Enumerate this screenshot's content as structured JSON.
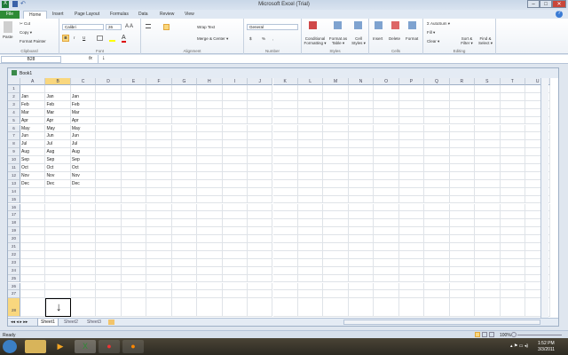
{
  "window": {
    "title": "Microsoft Excel (Trial)",
    "minimize": "–",
    "maximize": "□",
    "close": "✕"
  },
  "tabs": [
    "File",
    "Home",
    "Insert",
    "Page Layout",
    "Formulas",
    "Data",
    "Review",
    "View"
  ],
  "ribbon": {
    "clipboard": {
      "paste": "Paste",
      "cut": "Cut",
      "copy": "Copy ▾",
      "format_painter": "Format Painter",
      "label": "Clipboard"
    },
    "font": {
      "name": "Calibri",
      "size": "26",
      "bold": "B",
      "italic": "I",
      "underline": "U",
      "label": "Font"
    },
    "alignment": {
      "wrap": "Wrap Text",
      "merge": "Merge & Center ▾",
      "label": "Alignment"
    },
    "number": {
      "format": "General",
      "currency": "$",
      "percent": "%",
      "comma": ",",
      "label": "Number"
    },
    "styles": {
      "conditional": "Conditional Formatting ▾",
      "table": "Format as Table ▾",
      "cell": "Cell Styles ▾",
      "label": "Styles"
    },
    "cells": {
      "insert": "Insert",
      "delete": "Delete",
      "format": "Format",
      "label": "Cells"
    },
    "editing": {
      "autosum": "AutoSum ▾",
      "fill": "Fill ▾",
      "clear": "Clear ▾",
      "sort": "Sort & Filter ▾",
      "find": "Find & Select ▾",
      "label": "Editing"
    }
  },
  "formula_bar": {
    "name_box": "B28",
    "fx": "fx",
    "value": "↓"
  },
  "workbook": {
    "title": "Book1"
  },
  "columns": [
    "A",
    "B",
    "C",
    "D",
    "E",
    "F",
    "G",
    "H",
    "I",
    "J",
    "K",
    "L",
    "M",
    "N",
    "O",
    "P",
    "Q",
    "R",
    "S",
    "T",
    "U"
  ],
  "cells": {
    "months": [
      "Jan",
      "Feb",
      "Mar",
      "Apr",
      "May",
      "Jun",
      "Jul",
      "Aug",
      "Sep",
      "Oct",
      "Nov",
      "Dec"
    ],
    "B28": "↓"
  },
  "selected": {
    "column": "B",
    "row": 28
  },
  "sheets": [
    "Sheet1",
    "Sheet2",
    "Sheet3"
  ],
  "status": {
    "ready": "Ready",
    "zoom": "100%"
  },
  "taskbar": {
    "time": "1:52 PM",
    "date": "3/3/2011"
  }
}
